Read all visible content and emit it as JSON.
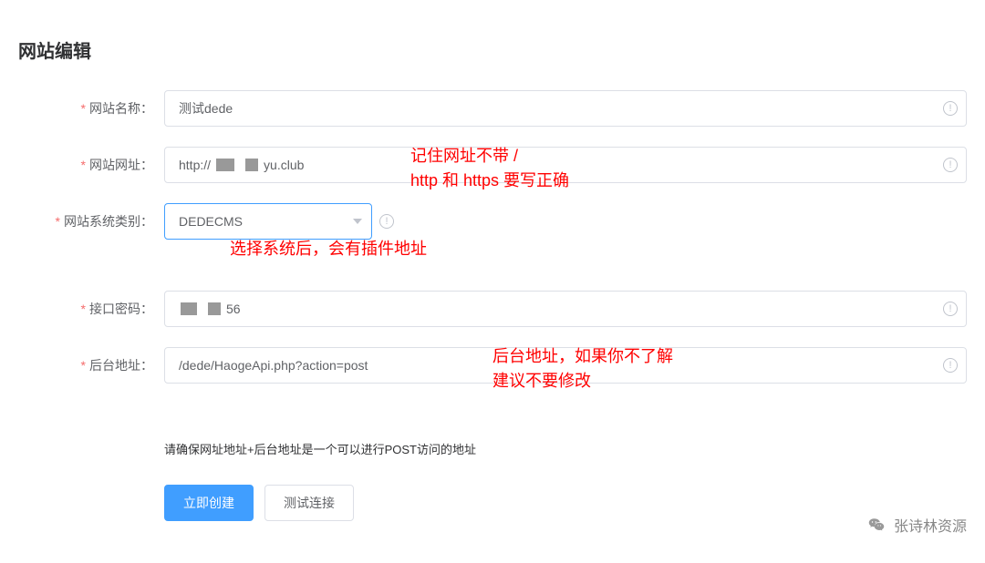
{
  "title": "网站编辑",
  "fields": {
    "siteName": {
      "label": "网站名称：",
      "value": "测试dede"
    },
    "siteUrl": {
      "label": "网站网址：",
      "value": "http://        yu.club"
    },
    "systemType": {
      "label": "网站系统类别：",
      "value": "DEDECMS"
    },
    "apiPassword": {
      "label": "接口密码：",
      "value": "        56"
    },
    "backendUrl": {
      "label": "后台地址：",
      "value": "/dede/HaogeApi.php?action=post"
    }
  },
  "helperText": "请确保网址地址+后台地址是一个可以进行POST访问的地址",
  "buttons": {
    "create": "立即创建",
    "test": "测试连接"
  },
  "annotations": {
    "url": "记住网址不带 /\nhttp 和 https 要写正确",
    "system": "选择系统后，会有插件地址",
    "backend": "后台地址，如果你不了解\n建议不要修改"
  },
  "signature": "张诗林资源"
}
